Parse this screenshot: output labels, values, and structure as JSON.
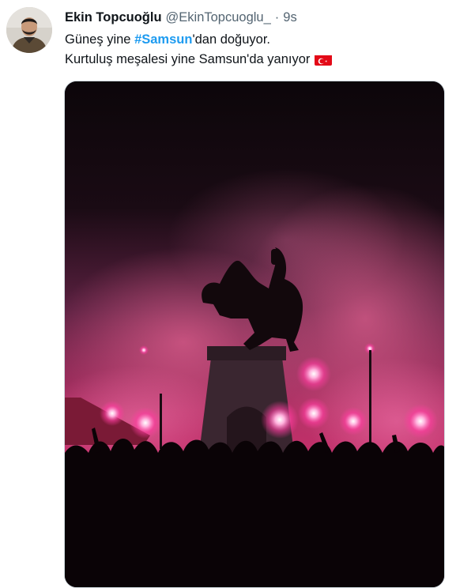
{
  "tweet": {
    "author": {
      "display_name": "Ekin Topcuoğlu",
      "handle": "@EkinTopcuoglu_",
      "avatar_icon": "user-avatar"
    },
    "separator": "·",
    "timestamp": "9s",
    "text": {
      "line1_before": "Güneş yine ",
      "hashtag": "#Samsun",
      "line1_after": "'dan doğuyor.",
      "line2": "Kurtuluş meşalesi yine Samsun'da yanıyor",
      "emoji": "turkey-flag"
    },
    "media": {
      "type": "photo",
      "subject": "statue-with-red-flares-crowd"
    },
    "colors": {
      "hashtag": "#1d9bf0",
      "secondary_text": "#536471",
      "primary_text": "#0f1419",
      "flag_red": "#e30a17"
    }
  }
}
